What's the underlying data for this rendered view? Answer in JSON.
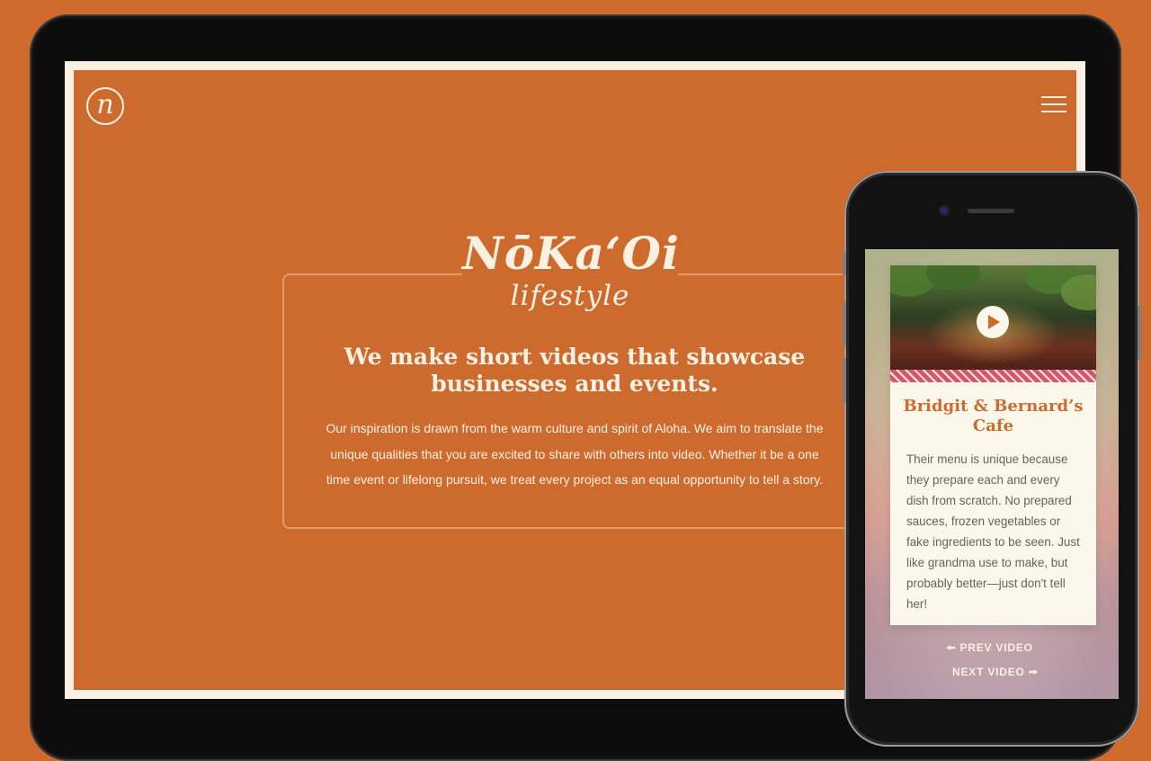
{
  "desktop": {
    "logo_letter": "n",
    "brand": {
      "name": "NōKa‘Oi",
      "tagline": "lifestyle"
    },
    "headline": "We make short videos that showcase businesses and events.",
    "blurb": "Our inspiration is drawn from the warm culture and spirit of Aloha. We aim to translate the unique qualities that you are excited to share with others into video. Whether it be a one time event or lifelong pursuit, we treat every project as an equal opportunity to tell a story."
  },
  "mobile": {
    "video_card": {
      "title": "Bridgit & Bernard’s Cafe",
      "description": "Their menu is unique because they prepare each and every dish from scratch. No prepared sauces, frozen vegetables or fake ingredients to be seen. Just like grandma use to make, but probably better—just don't tell her!"
    },
    "prev_label": "PREV VIDEO",
    "next_label": "NEXT VIDEO",
    "prev_arrow": "🠘",
    "next_arrow": "🠚"
  },
  "colors": {
    "background": "#cf6b2f",
    "brand_orange": "#cd6b2e",
    "cream": "#fbf1e3"
  }
}
